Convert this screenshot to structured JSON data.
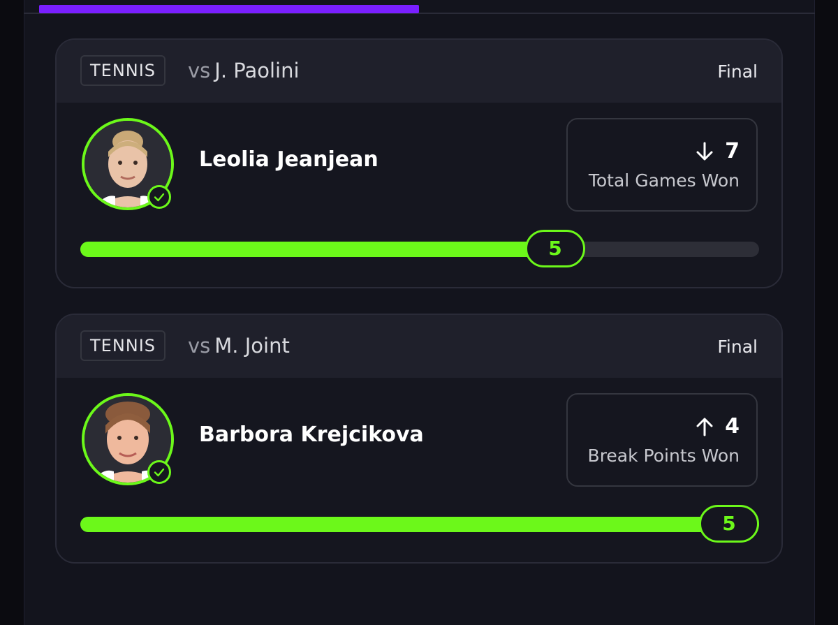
{
  "cards": [
    {
      "sport": "TENNIS",
      "vs": "vs",
      "opponent": "J. Paolini",
      "status": "Final",
      "player": "Leolia Jeanjean",
      "stat_direction": "down",
      "stat_value": "7",
      "stat_label": "Total Games Won",
      "progress_value": "5",
      "progress_fraction": 0.7,
      "avatar_icon": "player-photo",
      "check_icon": "check-circle-icon"
    },
    {
      "sport": "TENNIS",
      "vs": "vs",
      "opponent": "M. Joint",
      "status": "Final",
      "player": "Barbora Krejcikova",
      "stat_direction": "up",
      "stat_value": "4",
      "stat_label": "Break Points Won",
      "progress_value": "5",
      "progress_fraction": 1.0,
      "avatar_icon": "player-photo",
      "check_icon": "check-circle-icon"
    }
  ],
  "colors": {
    "accent": "#6cf81a",
    "tab_indicator": "#7a1fff",
    "background": "#13141d",
    "header": "#1f202b"
  }
}
